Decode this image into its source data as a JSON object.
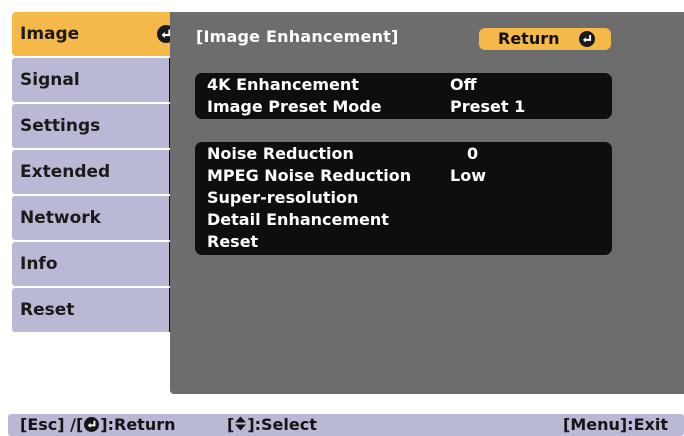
{
  "sidebar": {
    "items": [
      {
        "label": "Image",
        "active": true
      },
      {
        "label": "Signal",
        "active": false
      },
      {
        "label": "Settings",
        "active": false
      },
      {
        "label": "Extended",
        "active": false
      },
      {
        "label": "Network",
        "active": false
      },
      {
        "label": "Info",
        "active": false
      },
      {
        "label": "Reset",
        "active": false
      }
    ]
  },
  "panel": {
    "title": "[Image Enhancement]",
    "return_label": "Return",
    "group1": [
      {
        "label": "4K Enhancement",
        "value": "Off"
      },
      {
        "label": "Image Preset Mode",
        "value": "Preset 1"
      }
    ],
    "group2": [
      {
        "label": "Noise Reduction",
        "value": "0"
      },
      {
        "label": "MPEG Noise Reduction",
        "value": "Low"
      },
      {
        "label": "Super-resolution",
        "value": ""
      },
      {
        "label": "Detail Enhancement",
        "value": ""
      },
      {
        "label": "Reset",
        "value": ""
      }
    ]
  },
  "hint_bar": {
    "esc_prefix": "[Esc] /[",
    "esc_suffix": "]:Return",
    "select_prefix": "[",
    "select_suffix": "]:Select",
    "menu": "[Menu]:Exit"
  },
  "icons": {
    "return": "enter-arrow-icon",
    "select": "up-down-icon"
  },
  "colors": {
    "accent": "#f5b94a",
    "tab": "#b9b9d6",
    "panel": "#6d6d6d",
    "row": "#0e0e0e"
  }
}
